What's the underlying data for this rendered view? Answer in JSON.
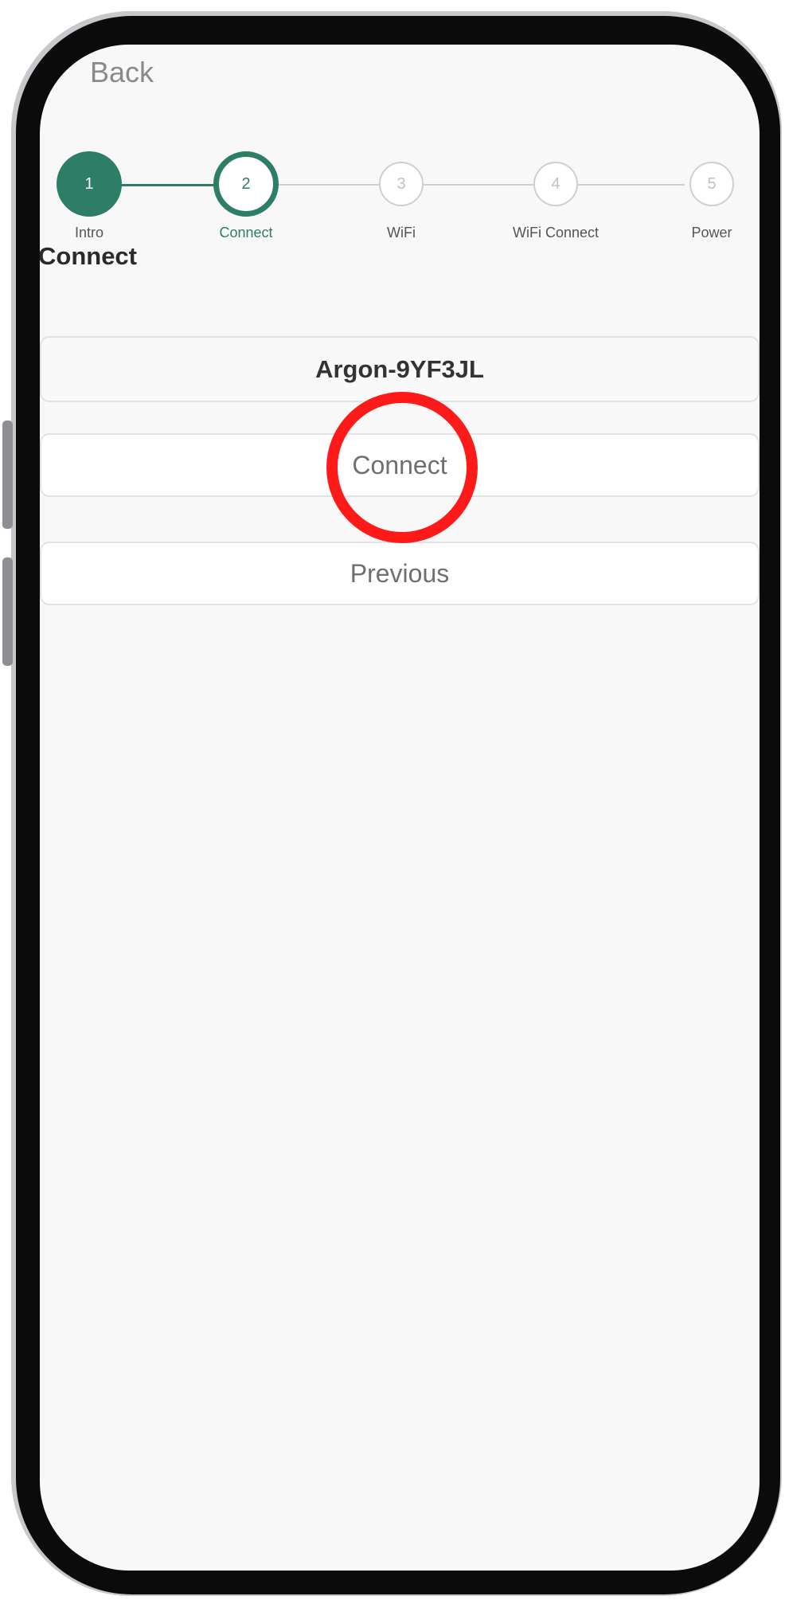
{
  "header": {
    "back_label": "Back"
  },
  "stepper": {
    "steps": [
      {
        "number": "1",
        "label": "Intro",
        "state": "done"
      },
      {
        "number": "2",
        "label": "Connect",
        "state": "current"
      },
      {
        "number": "3",
        "label": "WiFi",
        "state": "todo"
      },
      {
        "number": "4",
        "label": "WiFi Connect",
        "state": "todo"
      },
      {
        "number": "5",
        "label": "Power",
        "state": "todo"
      }
    ]
  },
  "main": {
    "title": "Connect",
    "device_name": "Argon-9YF3JL",
    "connect_label": "Connect",
    "previous_label": "Previous"
  },
  "colors": {
    "accent": "#2e7d66",
    "highlight": "#ff1a1a",
    "screen_bg": "#f8f8f8"
  },
  "icons": [
    "highlight-ring"
  ]
}
